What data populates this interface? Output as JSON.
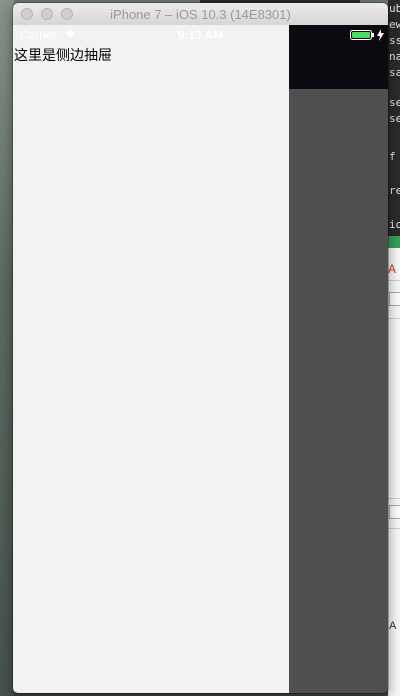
{
  "window": {
    "title": "iPhone 7 – iOS 10.3 (14E8301)"
  },
  "status_bar": {
    "carrier": "Carrier",
    "time": "9:13 AM",
    "wifi_icon": "wifi-icon",
    "battery_icon": "battery-icon",
    "charging_icon": "bolt-icon",
    "battery_color": "#4cd964"
  },
  "drawer": {
    "label": "这里是侧边抽屉"
  },
  "colors": {
    "drawer_bg": "#f2f2f2",
    "overlay_bg": "#4f4f4f",
    "nav_bg": "#0a0a10"
  }
}
